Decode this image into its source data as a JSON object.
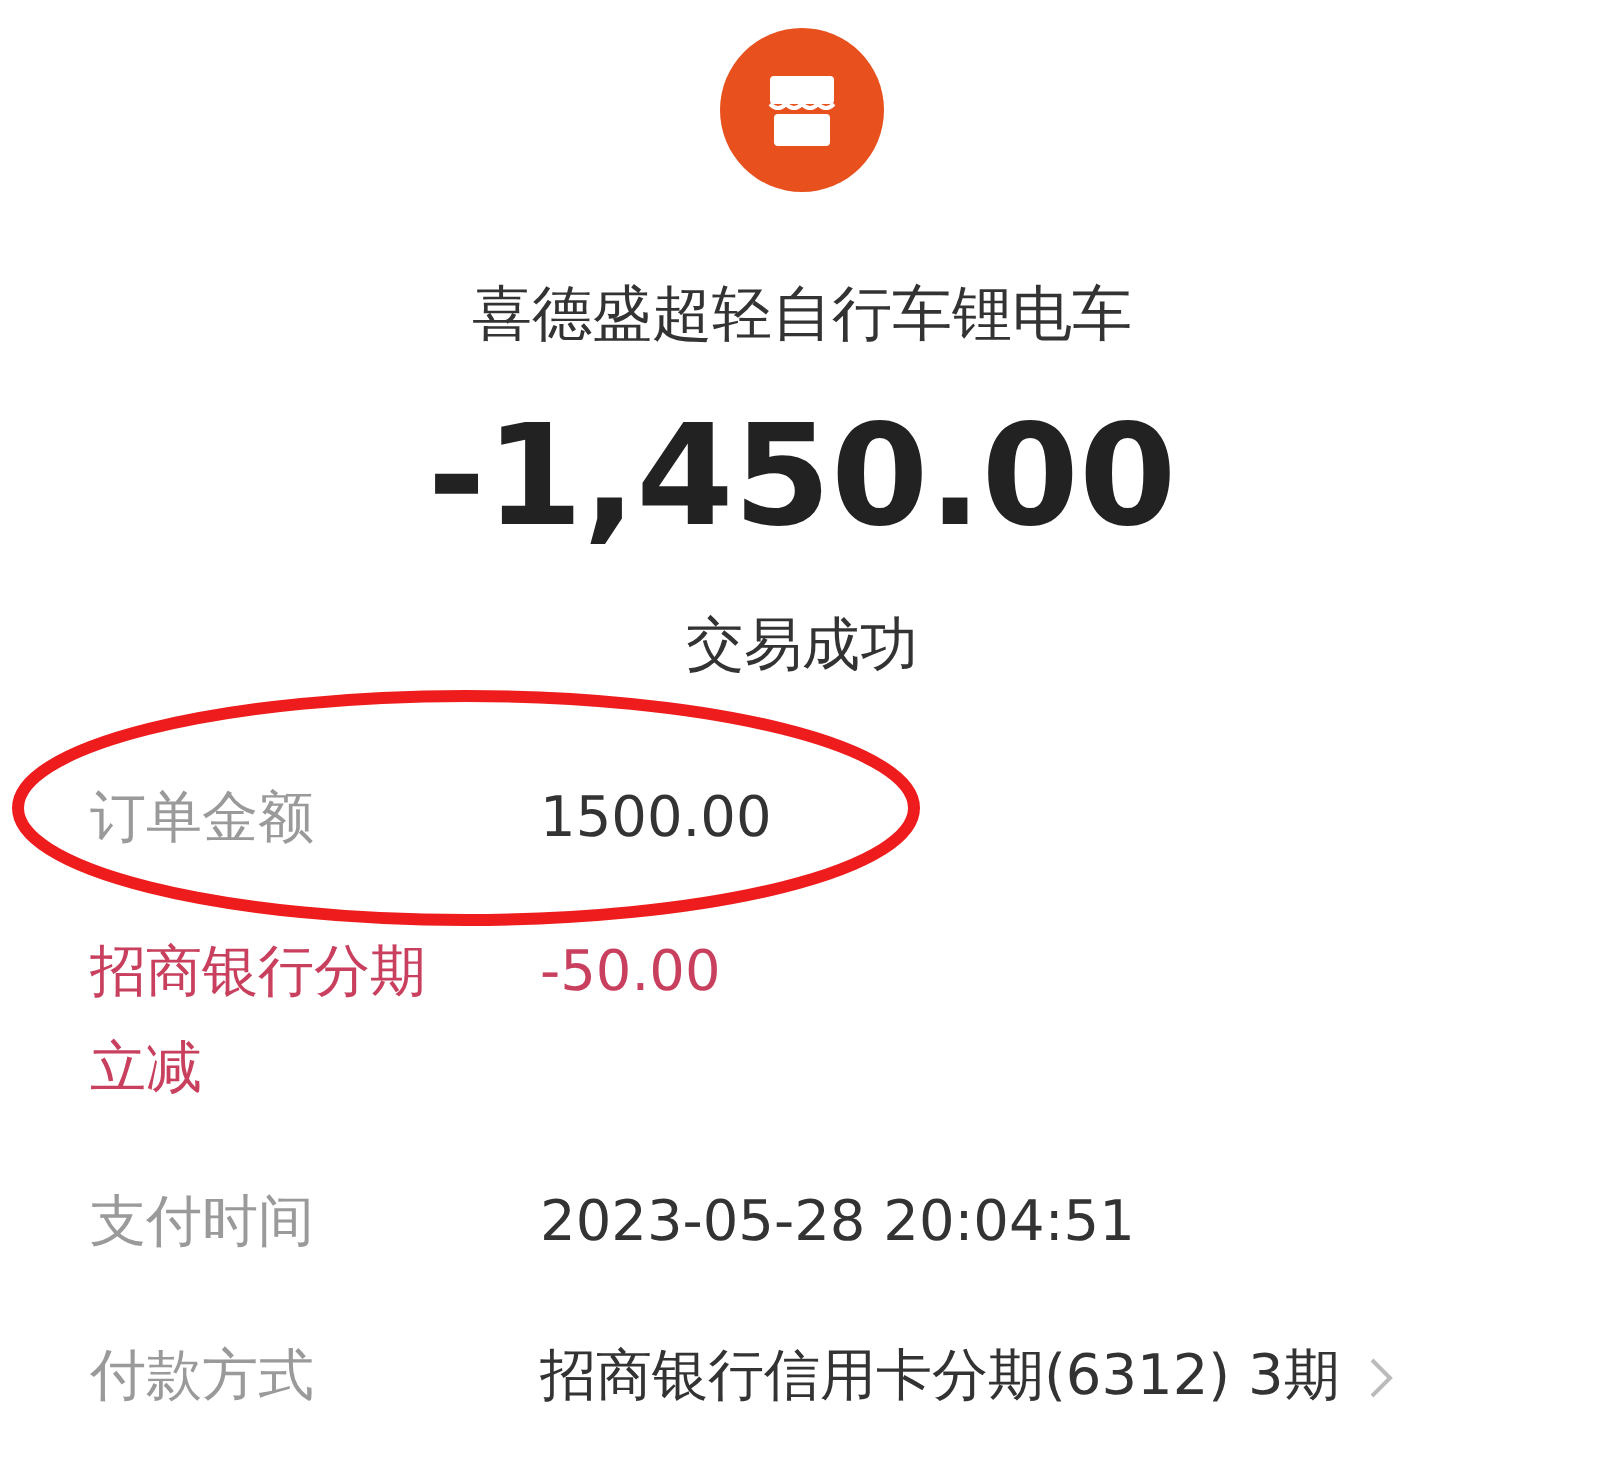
{
  "merchant": {
    "name": "喜德盛超轻自行车锂电车"
  },
  "amount": "-1,450.00",
  "status": "交易成功",
  "details": [
    {
      "label": "订单金额",
      "value": "1500.00",
      "kind": "normal",
      "circled": true,
      "link": false
    },
    {
      "label": "招商银行分期立减",
      "value": "-50.00",
      "kind": "discount",
      "circled": false,
      "link": false
    },
    {
      "label": "支付时间",
      "value": "2023-05-28 20:04:51",
      "kind": "normal",
      "circled": false,
      "link": false
    },
    {
      "label": "付款方式",
      "value": "招商银行信用卡分期(6312) 3期",
      "kind": "normal",
      "circled": false,
      "link": true
    }
  ]
}
